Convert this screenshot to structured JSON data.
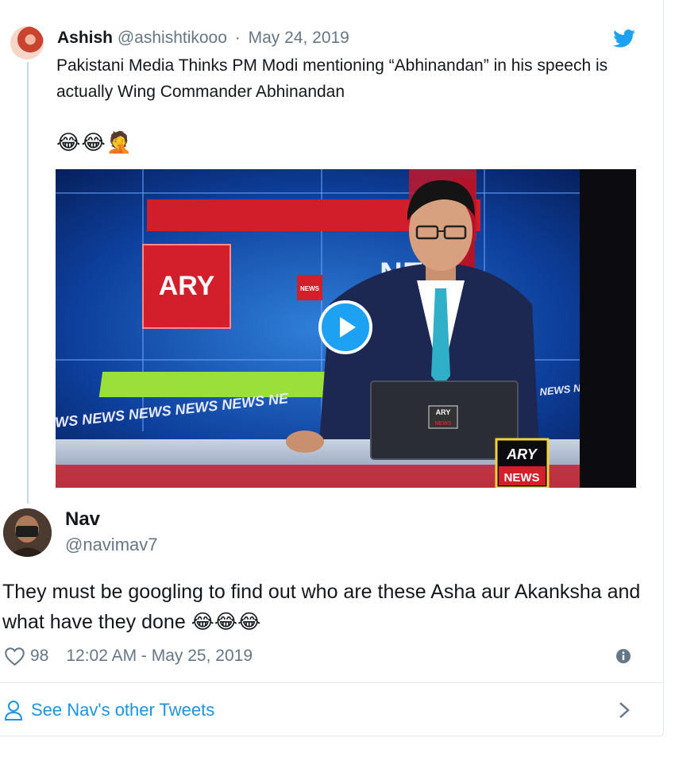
{
  "quoted_tweet": {
    "author_name": "Ashish",
    "author_handle": "@ashishtikooo",
    "separator": "·",
    "date": "May 24, 2019",
    "text": "Pakistani Media Thinks PM Modi mentioning “Abhinandan” in his speech is actually Wing Commander Abhinandan",
    "emojis": "😂😂🤦",
    "media": {
      "channel_logo": "ARY",
      "small_logo": "NEWS",
      "ticker": "WS NEWS NEWS NEWS NEWS NE",
      "right_ticker": "NEWS N",
      "laptop_logo_top": "ARY",
      "laptop_logo_bottom": "NEWS",
      "corner_logo_top": "ARY",
      "corner_logo_bottom": "NEWS",
      "bg_letters": "NE"
    }
  },
  "reply": {
    "author_name": "Nav",
    "author_handle": "@navimav7",
    "text": "They must be googling to find out who are these Asha aur Akanksha and what have they done 😂😂😂",
    "like_count": "98",
    "timestamp": "12:02 AM - May 25, 2019"
  },
  "footer": {
    "link_label": "See Nav's other Tweets"
  },
  "colors": {
    "accent": "#1da1f2",
    "link": "#1b95e0",
    "secondary_text": "#657786",
    "border": "#e1e8ed"
  },
  "icons": [
    "twitter-bird-icon",
    "play-icon",
    "heart-icon",
    "info-icon",
    "person-icon",
    "chevron-right-icon"
  ]
}
